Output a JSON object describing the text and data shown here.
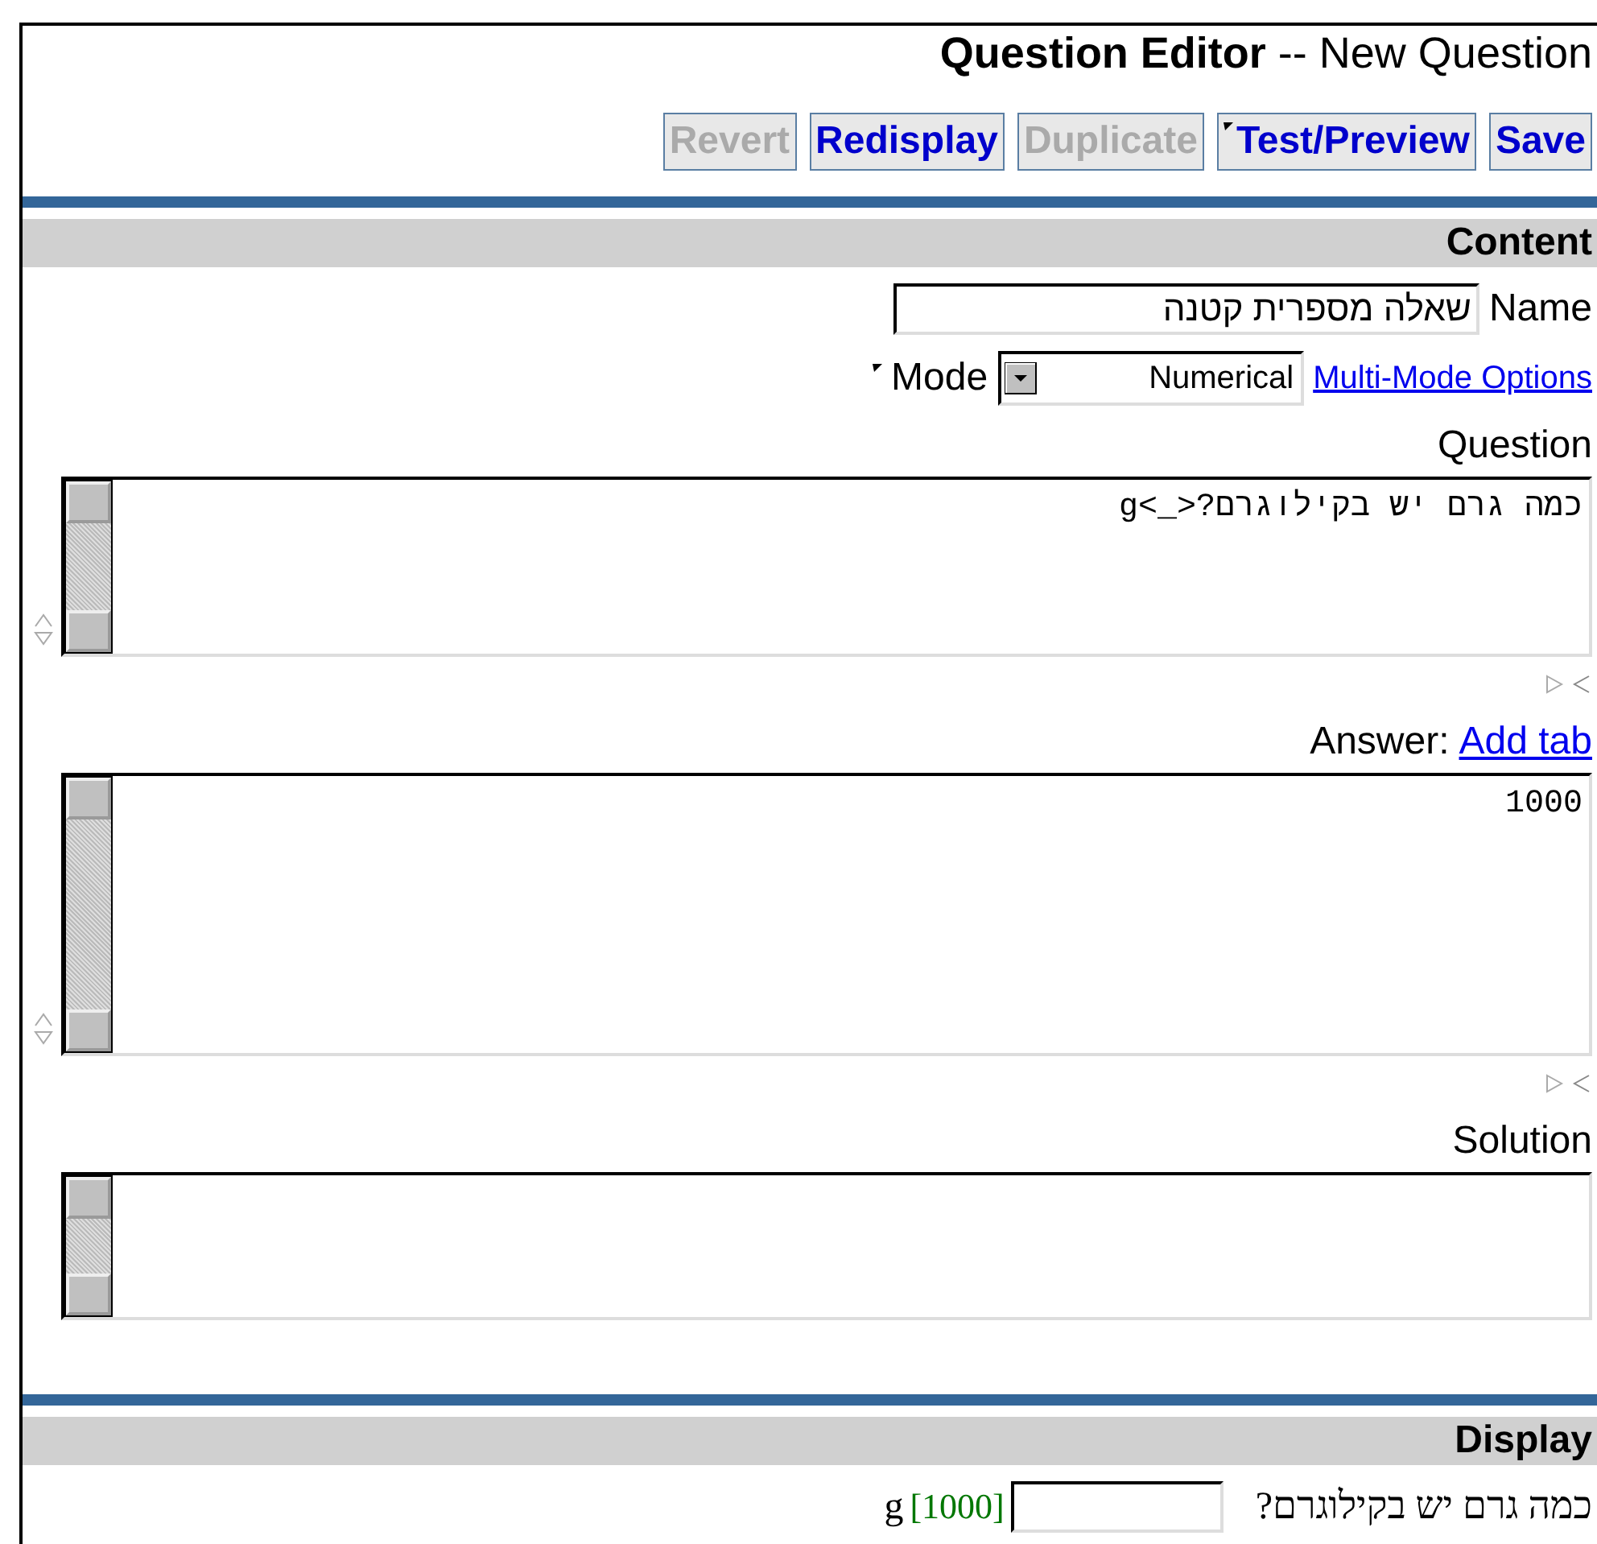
{
  "header": {
    "title": "**Question Editor** -- New Question"
  },
  "toolbar": [
    {
      "label": "Revert",
      "disabled": true,
      "marked": false
    },
    {
      "label": "Redisplay",
      "disabled": false,
      "marked": false
    },
    {
      "label": "Duplicate",
      "disabled": true,
      "marked": false
    },
    {
      "label": "Test/Preview",
      "disabled": false,
      "marked": true
    },
    {
      "label": "Save",
      "disabled": false,
      "marked": false
    }
  ],
  "content": {
    "heading": "Content",
    "name": {
      "label": "Name",
      "value": "שאלה מספרית קטנה"
    },
    "mode": {
      "label": "Mode",
      "value": "Numerical",
      "link": "Multi-Mode Options"
    },
    "editors": [
      {
        "label": "Question",
        "value": "כמה גרם יש בקילוגרם?<_>g",
        "resizable": true
      },
      {
        "label": "Answer:",
        "link": "Add tab",
        "value": "1000",
        "resizable": true
      },
      {
        "label": "Solution",
        "resizable": false
      }
    ]
  },
  "display": {
    "heading": "Display",
    "prompt": "כמה גרם יש בקילוגרם?",
    "answer": "[1000]",
    "unit": "g"
  }
}
